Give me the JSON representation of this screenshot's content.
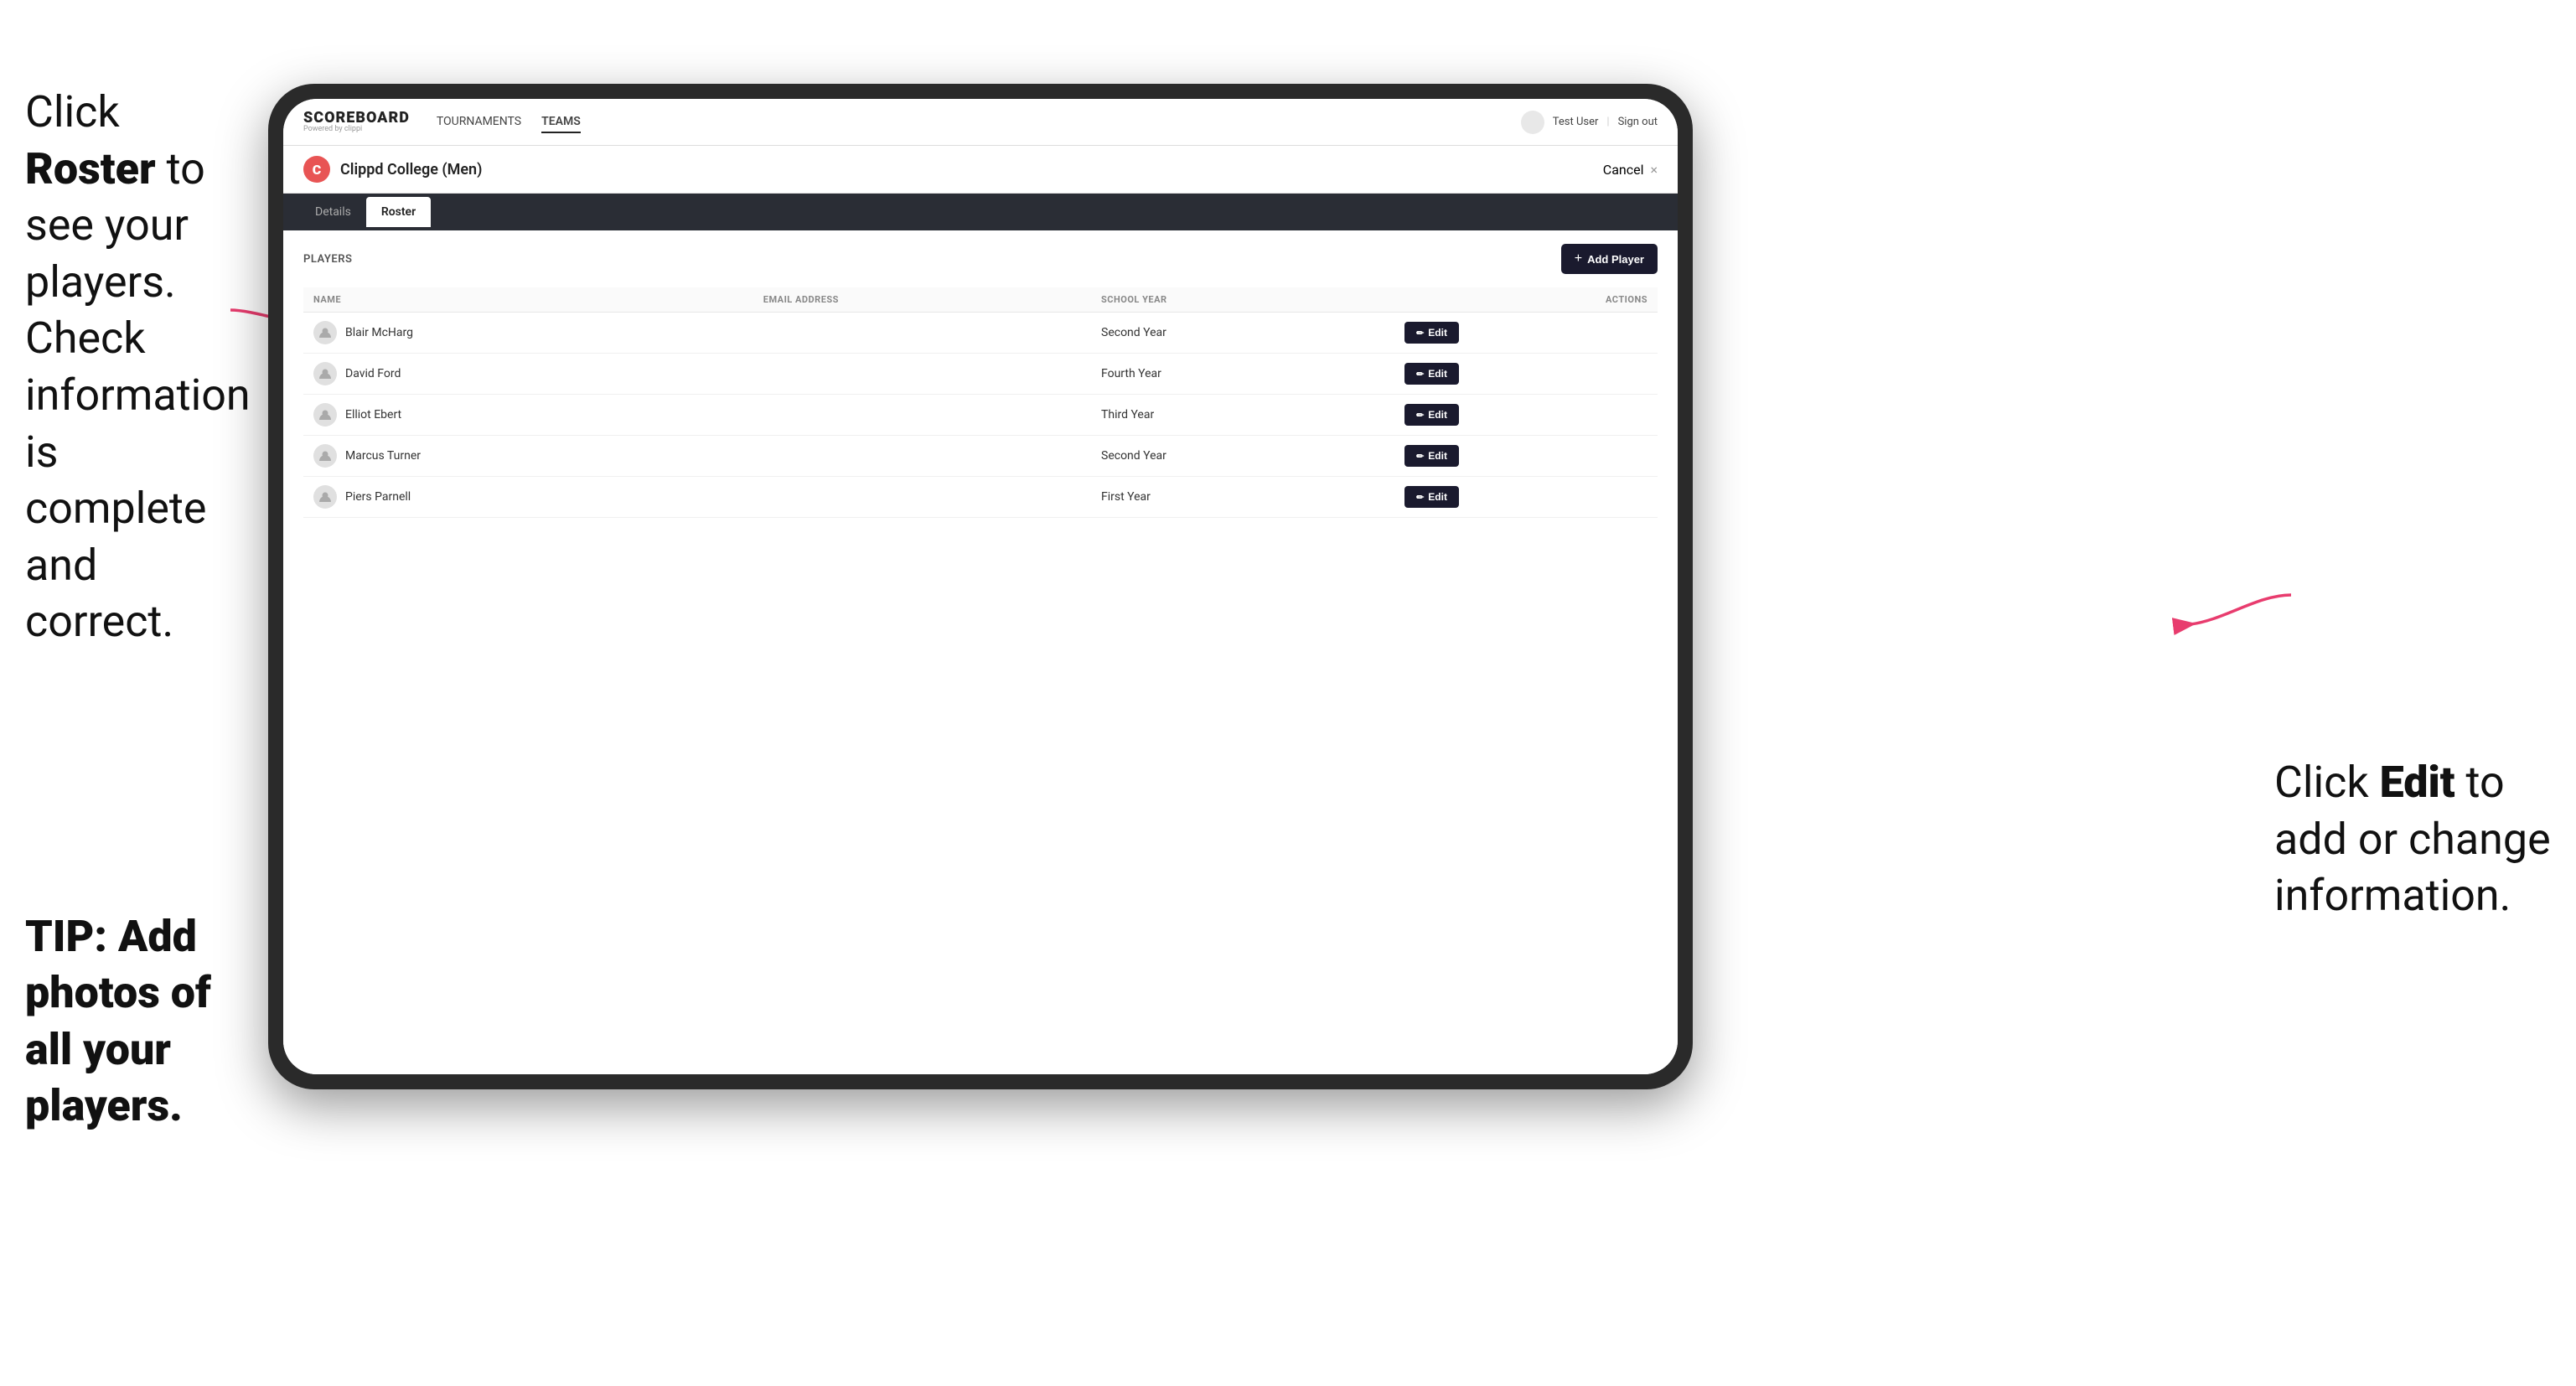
{
  "instructions": {
    "left_main": "Click ",
    "left_bold": "Roster",
    "left_rest": " to see your players. Check information is complete and correct.",
    "tip_label": "TIP: Add photos of all your players.",
    "right_main": "Click ",
    "right_bold": "Edit",
    "right_rest": " to add or change information."
  },
  "nav": {
    "brand_name": "SCOREBOARD",
    "brand_sub": "Powered by clippi",
    "links": [
      {
        "label": "TOURNAMENTS",
        "active": false
      },
      {
        "label": "TEAMS",
        "active": true
      }
    ],
    "user_text": "Test User",
    "signout": "Sign out"
  },
  "team": {
    "logo_letter": "C",
    "name": "Clippd College (Men)",
    "cancel_label": "Cancel",
    "cancel_symbol": "×"
  },
  "tabs": [
    {
      "label": "Details",
      "active": false
    },
    {
      "label": "Roster",
      "active": true
    }
  ],
  "players_section": {
    "section_label": "PLAYERS",
    "add_button_label": "+ Add Player",
    "columns": {
      "name": "NAME",
      "email": "EMAIL ADDRESS",
      "school_year": "SCHOOL YEAR",
      "actions": "ACTIONS"
    },
    "players": [
      {
        "name": "Blair McHarg",
        "email": "",
        "school_year": "Second Year"
      },
      {
        "name": "David Ford",
        "email": "",
        "school_year": "Fourth Year"
      },
      {
        "name": "Elliot Ebert",
        "email": "",
        "school_year": "Third Year"
      },
      {
        "name": "Marcus Turner",
        "email": "",
        "school_year": "Second Year"
      },
      {
        "name": "Piers Parnell",
        "email": "",
        "school_year": "First Year"
      }
    ],
    "edit_button_label": "Edit"
  }
}
